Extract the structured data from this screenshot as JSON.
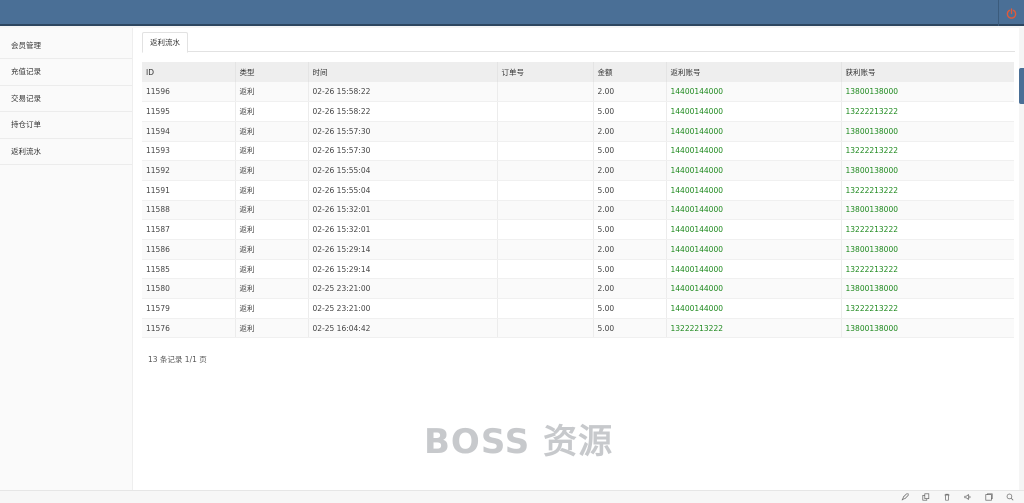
{
  "sidebar": {
    "items": [
      {
        "label": "会员管理"
      },
      {
        "label": "充值记录"
      },
      {
        "label": "交易记录"
      },
      {
        "label": "持仓订单"
      },
      {
        "label": "返利流水"
      }
    ]
  },
  "tabs": [
    {
      "label": "返利流水"
    }
  ],
  "table": {
    "headers": [
      "ID",
      "类型",
      "时间",
      "订单号",
      "金额",
      "返利账号",
      "获利账号"
    ],
    "rows": [
      [
        "11596",
        "返利",
        "02-26 15:58:22",
        "",
        "2.00",
        "14400144000",
        "13800138000"
      ],
      [
        "11595",
        "返利",
        "02-26 15:58:22",
        "",
        "5.00",
        "14400144000",
        "13222213222"
      ],
      [
        "11594",
        "返利",
        "02-26 15:57:30",
        "",
        "2.00",
        "14400144000",
        "13800138000"
      ],
      [
        "11593",
        "返利",
        "02-26 15:57:30",
        "",
        "5.00",
        "14400144000",
        "13222213222"
      ],
      [
        "11592",
        "返利",
        "02-26 15:55:04",
        "",
        "2.00",
        "14400144000",
        "13800138000"
      ],
      [
        "11591",
        "返利",
        "02-26 15:55:04",
        "",
        "5.00",
        "14400144000",
        "13222213222"
      ],
      [
        "11588",
        "返利",
        "02-26 15:32:01",
        "",
        "2.00",
        "14400144000",
        "13800138000"
      ],
      [
        "11587",
        "返利",
        "02-26 15:32:01",
        "",
        "5.00",
        "14400144000",
        "13222213222"
      ],
      [
        "11586",
        "返利",
        "02-26 15:29:14",
        "",
        "2.00",
        "14400144000",
        "13800138000"
      ],
      [
        "11585",
        "返利",
        "02-26 15:29:14",
        "",
        "5.00",
        "14400144000",
        "13222213222"
      ],
      [
        "11580",
        "返利",
        "02-25 23:21:00",
        "",
        "2.00",
        "14400144000",
        "13800138000"
      ],
      [
        "11579",
        "返利",
        "02-25 23:21:00",
        "",
        "5.00",
        "14400144000",
        "13222213222"
      ],
      [
        "11576",
        "返利",
        "02-25 16:04:42",
        "",
        "5.00",
        "13222213222",
        "13800138000"
      ]
    ]
  },
  "pager": {
    "text": "13 条记录 1/1 页"
  },
  "watermark": {
    "text": "BOSS 资源"
  },
  "icons": {
    "header": [
      "power-icon"
    ],
    "status": [
      "rocket-icon",
      "copy-icon",
      "trash-icon",
      "speaker-icon",
      "window-icon",
      "search-icon"
    ]
  },
  "colors": {
    "header": "#4a6f96",
    "account_link": "#1f8a1f",
    "power_icon": "#e05a3a"
  }
}
